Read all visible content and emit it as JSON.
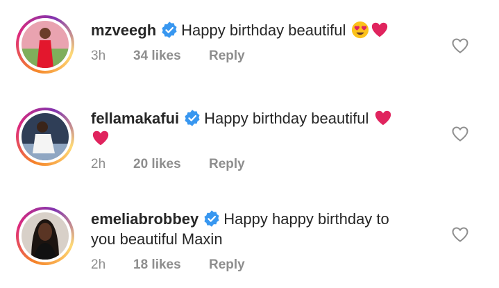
{
  "comments": [
    {
      "username": "mzveegh",
      "text": "Happy birthday beautiful",
      "text_line2": "",
      "emojis": [
        "heart-eyes",
        "red-heart"
      ],
      "time": "3h",
      "likes": "34 likes",
      "reply": "Reply"
    },
    {
      "username": "fellamakafui",
      "text": "Happy birthday beautiful",
      "text_line2": "",
      "emojis": [
        "red-heart",
        "red-heart"
      ],
      "time": "2h",
      "likes": "20 likes",
      "reply": "Reply"
    },
    {
      "username": "emeliabrobbey",
      "text": "Happy happy birthday to",
      "text_line2": "you beautiful Maxin",
      "emojis": [],
      "time": "2h",
      "likes": "18 likes",
      "reply": "Reply"
    }
  ],
  "colors": {
    "verified": "#3897f0",
    "heart": "#e0245e",
    "meta": "#8e8e8e"
  }
}
